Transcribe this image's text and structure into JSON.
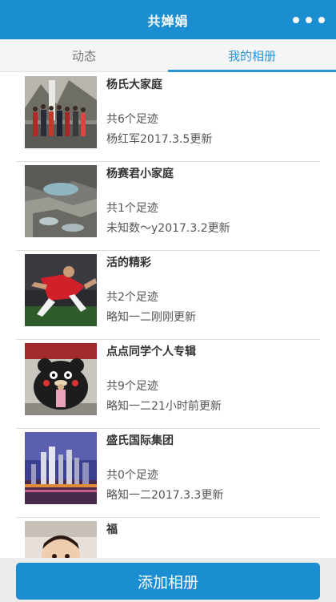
{
  "header": {
    "title": "共婵娟"
  },
  "tabs": [
    {
      "label": "动态"
    },
    {
      "label": "我的相册"
    }
  ],
  "albums": [
    {
      "name": "杨氏大家庭",
      "count": "共6个足迹",
      "updated": "杨红军2017.3.5更新"
    },
    {
      "name": "杨赛君小家庭",
      "count": "共1个足迹",
      "updated": "未知数～y2017.3.2更新"
    },
    {
      "name": "活的精彩",
      "count": "共2个足迹",
      "updated": "略知一二刚刚更新"
    },
    {
      "name": "点点同学个人专辑",
      "count": "共9个足迹",
      "updated": "略知一二21小时前更新"
    },
    {
      "name": "盛氏国际集团",
      "count": "共0个足迹",
      "updated": "略知一二2017.3.3更新"
    },
    {
      "name": "福"
    }
  ],
  "footer": {
    "add_button": "添加相册"
  },
  "colors": {
    "brand": "#1a8ed1",
    "tab_active": "#2a95d7"
  }
}
